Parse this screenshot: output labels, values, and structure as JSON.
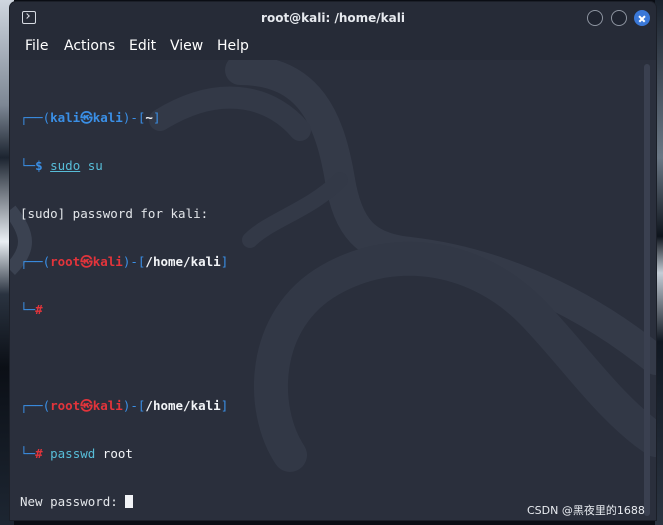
{
  "window": {
    "title": "root@kali: /home/kali"
  },
  "menu": {
    "items": [
      "File",
      "Actions",
      "Edit",
      "View",
      "Help"
    ]
  },
  "terminal": {
    "box_top": "┌──",
    "box_bottom": "└─",
    "prompt1": {
      "open": "(",
      "user": "kali",
      "at": "㉿",
      "host": "kali",
      "close": ")-[",
      "path": "~",
      "end": "]",
      "symbol": "$",
      "command": "sudo",
      "args": " su"
    },
    "output1": "[sudo] password for kali:",
    "prompt2": {
      "open": "(",
      "user": "root",
      "at": "㉿",
      "host": "kali",
      "close": ")-[",
      "path": "/home/kali",
      "end": "]",
      "symbol": "#"
    },
    "prompt3": {
      "open": "(",
      "user": "root",
      "at": "㉿",
      "host": "kali",
      "close": ")-[",
      "path": "/home/kali",
      "end": "]",
      "symbol": "#",
      "command": "passwd",
      "args": " root"
    },
    "output2": "New password: "
  },
  "watermark": "CSDN @黑夜里的1688",
  "colors": {
    "prompt_blue": "#3a8fe6",
    "root_red": "#e2343b",
    "close_button": "#3a78d8"
  },
  "icons": {
    "window_icon": "terminal-icon",
    "close": "close-icon"
  }
}
